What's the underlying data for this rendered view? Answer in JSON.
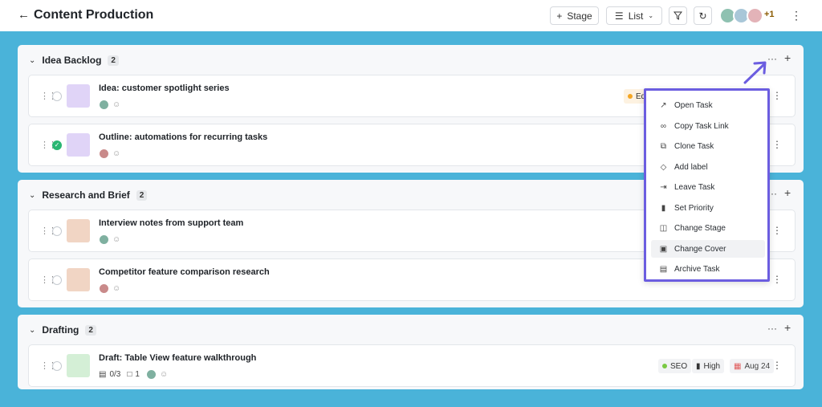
{
  "header": {
    "title": "Content Production",
    "back_icon": "arrow-left-icon",
    "stage_label": "Stage",
    "view_label": "List",
    "extra_members": "+1"
  },
  "groups": [
    {
      "name": "Idea Backlog",
      "count": "2",
      "tasks": [
        {
          "title": "Idea: customer spotlight series",
          "done": false,
          "thumb": "#e0d4f7",
          "tag": "Ed",
          "tag_color": "#f5a623"
        },
        {
          "title": "Outline: automations for recurring tasks",
          "done": true,
          "thumb": "#e0d4f7"
        }
      ]
    },
    {
      "name": "Research and Brief",
      "count": "2",
      "tasks": [
        {
          "title": "Interview notes from support team",
          "done": false,
          "thumb": "#f1d5c4"
        },
        {
          "title": "Competitor feature comparison research",
          "done": false,
          "thumb": "#f1d5c4"
        }
      ]
    },
    {
      "name": "Drafting",
      "count": "2",
      "tasks": [
        {
          "title": "Draft: Table View feature walkthrough",
          "done": false,
          "thumb": "#d4efd6",
          "checklist": "0/3",
          "comments": "1",
          "label": "SEO",
          "label_color": "#7ac943",
          "priority": "High",
          "date": "Aug 24"
        }
      ]
    }
  ],
  "menu": {
    "items": [
      {
        "label": "Open Task",
        "icon": "cursor-icon"
      },
      {
        "label": "Copy Task Link",
        "icon": "link-icon"
      },
      {
        "label": "Clone Task",
        "icon": "copy-icon"
      },
      {
        "label": "Add label",
        "icon": "tag-icon"
      },
      {
        "label": "Leave Task",
        "icon": "exit-icon"
      },
      {
        "label": "Set Priority",
        "icon": "bars-icon"
      },
      {
        "label": "Change Stage",
        "icon": "stage-icon"
      },
      {
        "label": "Change Cover",
        "icon": "image-icon"
      },
      {
        "label": "Archive Task",
        "icon": "archive-icon"
      }
    ],
    "highlighted": "Change Cover"
  },
  "colors": {
    "board_bg": "#4ab3d9",
    "menu_border": "#6b5de0",
    "arrow": "#6b5de0"
  }
}
